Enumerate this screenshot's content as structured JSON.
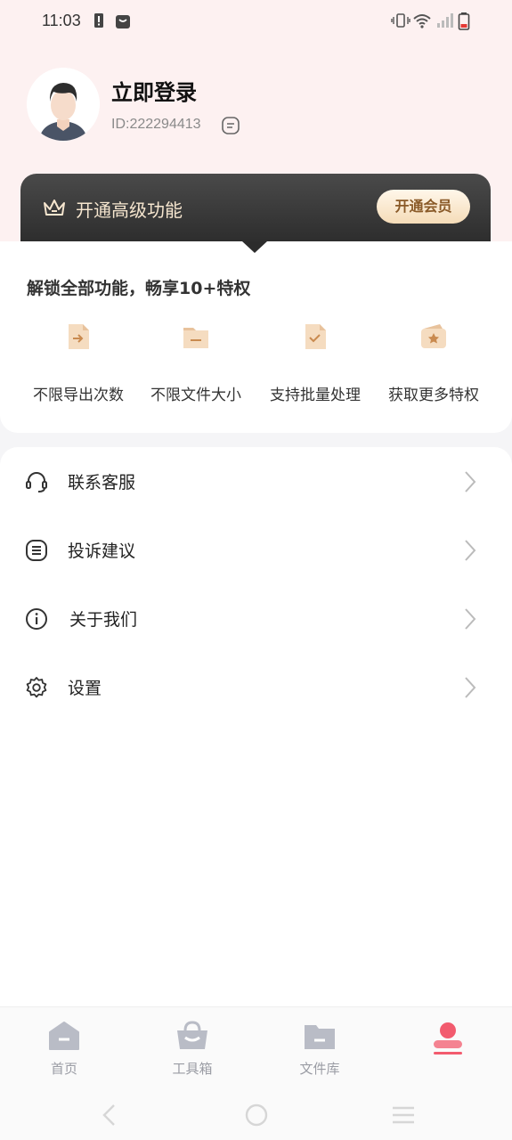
{
  "status_bar": {
    "time": "11:03"
  },
  "profile": {
    "login_label": "立即登录",
    "user_id": "ID:222294413"
  },
  "vip": {
    "title": "开通高级功能",
    "button_label": "开通会员"
  },
  "privileges": {
    "title": "解锁全部功能，畅享10+特权",
    "items": [
      {
        "label": "不限导出次数",
        "icon": "export-file-icon"
      },
      {
        "label": "不限文件大小",
        "icon": "folder-icon"
      },
      {
        "label": "支持批量处理",
        "icon": "batch-check-icon"
      },
      {
        "label": "获取更多特权",
        "icon": "star-card-icon"
      }
    ]
  },
  "menu": {
    "items": [
      {
        "label": "联系客服",
        "icon": "headset-icon"
      },
      {
        "label": "投诉建议",
        "icon": "feedback-icon"
      },
      {
        "label": "关于我们",
        "icon": "info-icon"
      },
      {
        "label": "设置",
        "icon": "gear-icon"
      }
    ]
  },
  "nav": {
    "items": [
      {
        "label": "首页",
        "icon": "home-icon"
      },
      {
        "label": "工具箱",
        "icon": "toolbox-icon"
      },
      {
        "label": "文件库",
        "icon": "folder-icon"
      },
      {
        "label": "",
        "icon": "profile-icon"
      }
    ]
  },
  "colors": {
    "header_bg": "#fdf1f1",
    "vip_gold": "#f6e6cf",
    "icon_peach": "#f5dcc0",
    "nav_active": "#f25b6e",
    "nav_inactive": "#b9bcc6"
  }
}
